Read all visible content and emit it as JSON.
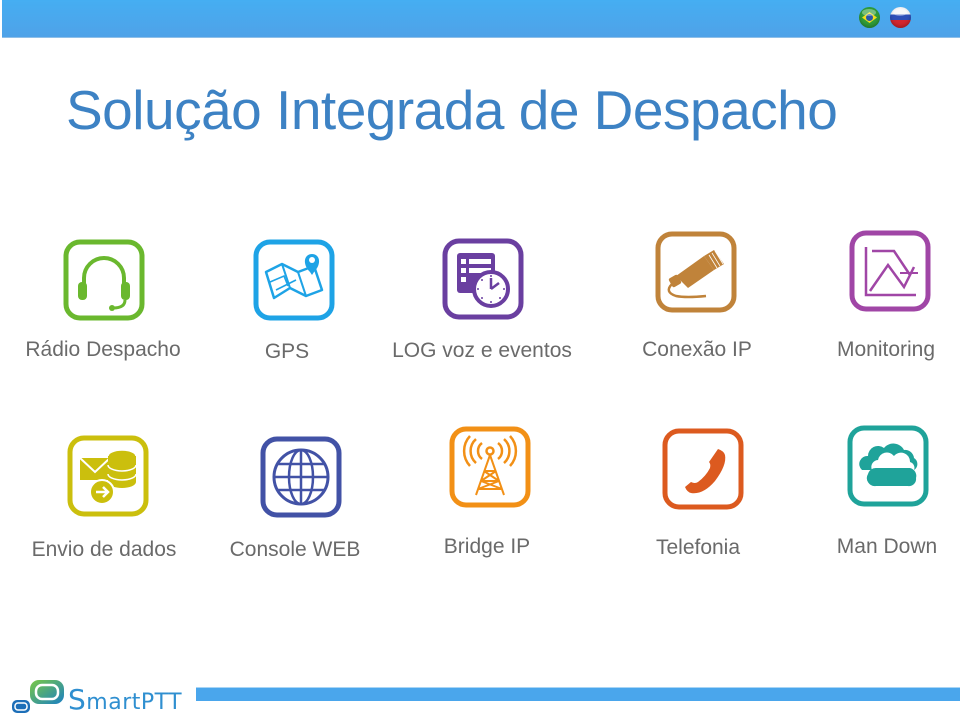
{
  "header": {
    "language_flags": [
      {
        "name": "brazil-flag",
        "label": "Português"
      },
      {
        "name": "russia-flag",
        "label": "Русский"
      }
    ]
  },
  "title": "Solução Integrada de Despacho",
  "features": [
    {
      "label": "Rádio Despacho",
      "icon": "headset-icon",
      "color": "#6ab82e"
    },
    {
      "label": "GPS",
      "icon": "map-pin-icon",
      "color": "#1ea3e6"
    },
    {
      "label": "LOG voz e eventos",
      "icon": "log-clock-icon",
      "color": "#6a3fa0"
    },
    {
      "label": "Conexão IP",
      "icon": "ethernet-plug-icon",
      "color": "#c0833a"
    },
    {
      "label": "Monitoring",
      "icon": "line-chart-icon",
      "color": "#a046a6"
    },
    {
      "label": "Envio de dados",
      "icon": "mail-database-icon",
      "color": "#cbbf0d"
    },
    {
      "label": "Console WEB",
      "icon": "globe-icon",
      "color": "#4252a6"
    },
    {
      "label": "Bridge IP",
      "icon": "radio-tower-icon",
      "color": "#f29016"
    },
    {
      "label": "Telefonia",
      "icon": "phone-icon",
      "color": "#dc5a1f"
    },
    {
      "label": "Man Down",
      "icon": "cloud-icon",
      "color": "#1fa39a"
    }
  ],
  "footer": {
    "brand_first_letter": "S",
    "brand_rest": "martPTT",
    "accent_color": "#4aa6ec"
  }
}
